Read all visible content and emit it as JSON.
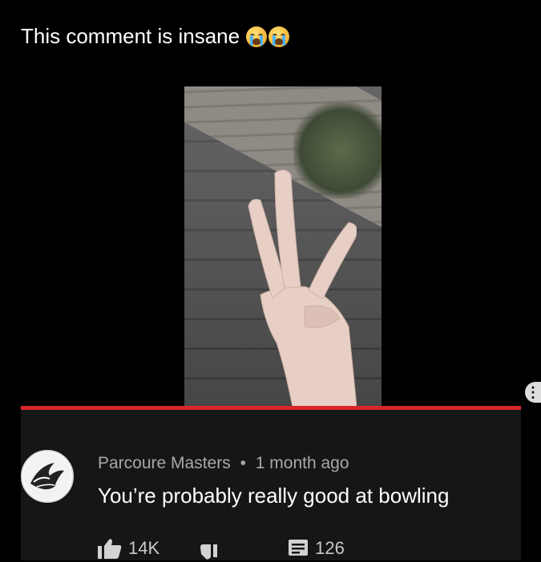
{
  "caption": {
    "text": "This comment is insane",
    "emoji_icons": [
      "loudly-crying-face-icon",
      "loudly-crying-face-icon"
    ]
  },
  "video": {
    "menu_icon": "more-options-icon",
    "progress_color": "#d9262b"
  },
  "comment": {
    "author": "Parcoure Masters",
    "separator": "•",
    "time": "1 month ago",
    "text": "You’re probably really good at bowling",
    "likes": "14K",
    "replies": "126",
    "icons": {
      "like": "thumbs-up-icon",
      "dislike": "thumbs-down-icon",
      "reply": "comment-icon"
    }
  }
}
